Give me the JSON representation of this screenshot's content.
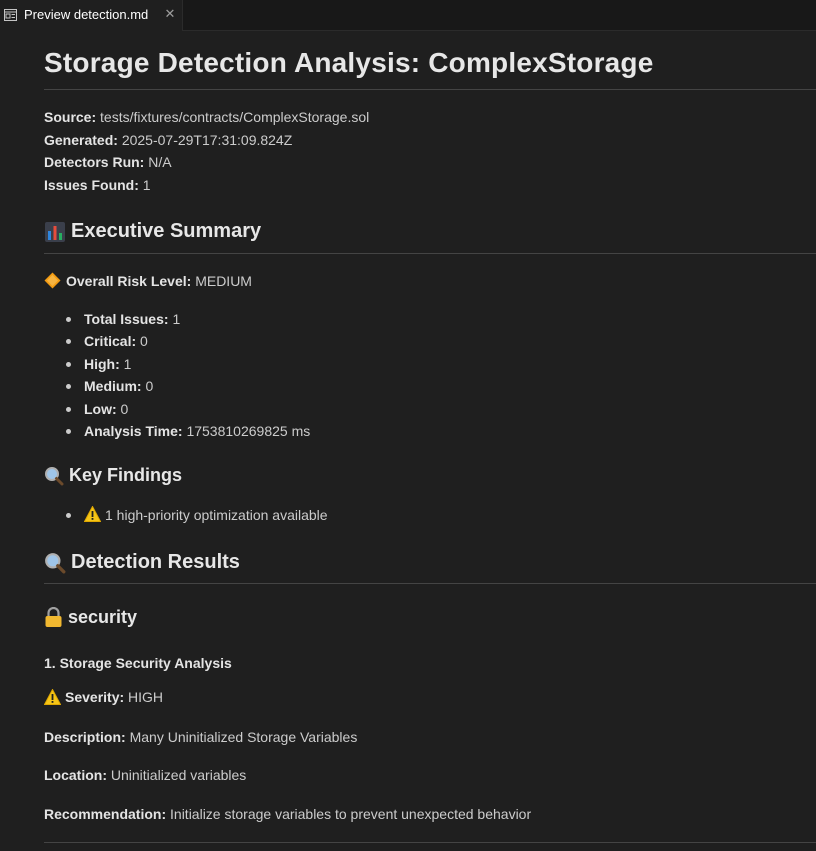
{
  "tab": {
    "label": "Preview detection.md",
    "icon": "preview-icon",
    "close_glyph": "✕"
  },
  "doc": {
    "title": "Storage Detection Analysis: ComplexStorage",
    "meta": [
      {
        "key": "Source:",
        "value": "tests/fixtures/contracts/ComplexStorage.sol"
      },
      {
        "key": "Generated:",
        "value": "2025-07-29T17:31:09.824Z"
      },
      {
        "key": "Detectors Run:",
        "value": "N/A"
      },
      {
        "key": "Issues Found:",
        "value": "1"
      }
    ],
    "executive_summary": {
      "heading": "Executive Summary",
      "icon": "bar-chart-icon",
      "risk_label": "Overall Risk Level:",
      "risk_value": "MEDIUM",
      "risk_icon": "orange-diamond-icon",
      "stats": [
        {
          "key": "Total Issues:",
          "value": "1"
        },
        {
          "key": "Critical:",
          "value": "0"
        },
        {
          "key": "High:",
          "value": "1"
        },
        {
          "key": "Medium:",
          "value": "0"
        },
        {
          "key": "Low:",
          "value": "0"
        },
        {
          "key": "Analysis Time:",
          "value": "1753810269825 ms"
        }
      ]
    },
    "key_findings": {
      "heading": "Key Findings",
      "icon": "magnifier-icon",
      "items": [
        {
          "icon": "warning-icon",
          "text": "1 high-priority optimization available"
        }
      ]
    },
    "detection_results": {
      "heading": "Detection Results",
      "icon": "magnifier-icon"
    },
    "security": {
      "heading": "security",
      "icon": "lock-icon",
      "item_title": "1. Storage Security Analysis",
      "severity_label": "Severity:",
      "severity_value": "HIGH",
      "severity_icon": "warning-icon",
      "description_label": "Description:",
      "description_value": "Many Uninitialized Storage Variables",
      "location_label": "Location:",
      "location_value": "Uninitialized variables",
      "recommendation_label": "Recommendation:",
      "recommendation_value": "Initialize storage variables to prevent unexpected behavior"
    }
  },
  "colors": {
    "background": "#1f1f1f",
    "tabbar": "#181818",
    "text": "#cccccc",
    "heading": "#e7e7e7",
    "rule": "#444444",
    "warning": "#f5c518",
    "diamond": "#f39c12"
  }
}
